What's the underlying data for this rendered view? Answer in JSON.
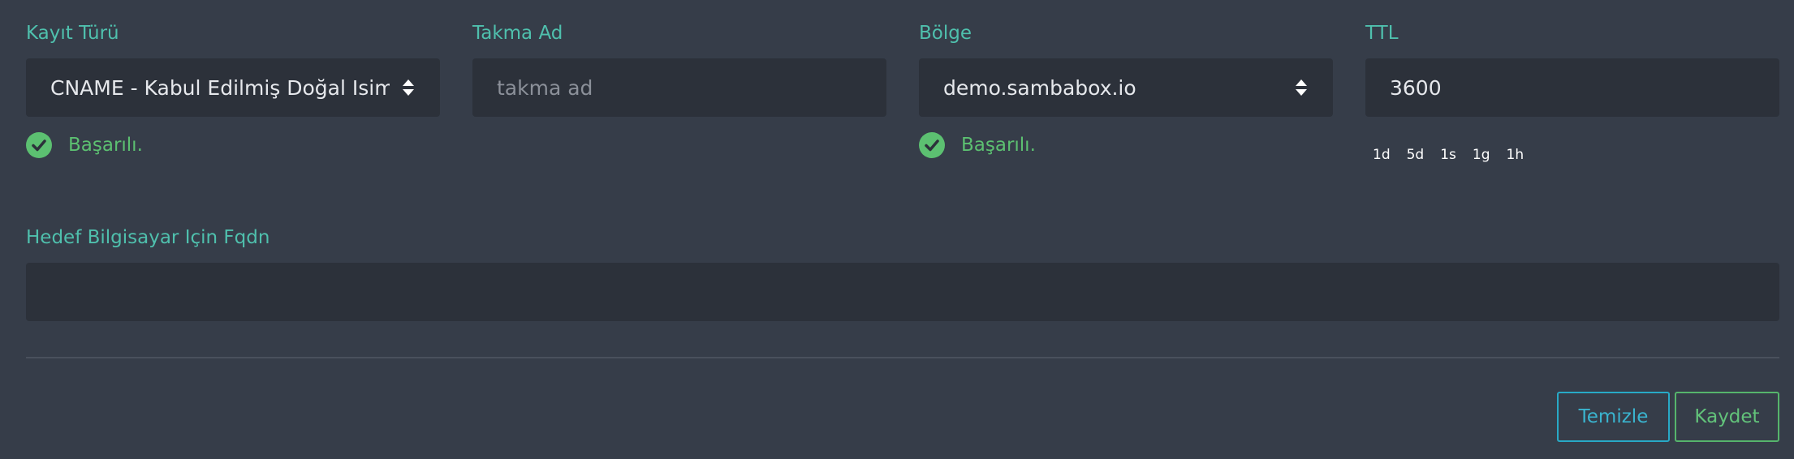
{
  "form": {
    "record_type": {
      "label": "Kayıt Türü",
      "value": "CNAME - Kabul Edilmiş Doğal Isim",
      "validation": "Başarılı."
    },
    "alias": {
      "label": "Takma Ad",
      "value": "",
      "placeholder": "takma ad"
    },
    "zone": {
      "label": "Bölge",
      "value": "demo.sambabox.io",
      "validation": "Başarılı."
    },
    "ttl": {
      "label": "TTL",
      "value": "3600",
      "shortcuts": [
        "1d",
        "5d",
        "1s",
        "1g",
        "1h"
      ]
    },
    "target_fqdn": {
      "label": "Hedef Bilgisayar Için Fqdn",
      "value": ""
    }
  },
  "actions": {
    "clear_label": "Temizle",
    "save_label": "Kaydet"
  },
  "colors": {
    "background": "#363d49",
    "input_background": "#2c313a",
    "label": "#4fc0ad",
    "success": "#5cc071",
    "clear_button": "#28a9c6",
    "save_button": "#56b56c"
  },
  "icons": {
    "select_caret": "sort-caret-icon",
    "valid": "check-circle-icon"
  }
}
